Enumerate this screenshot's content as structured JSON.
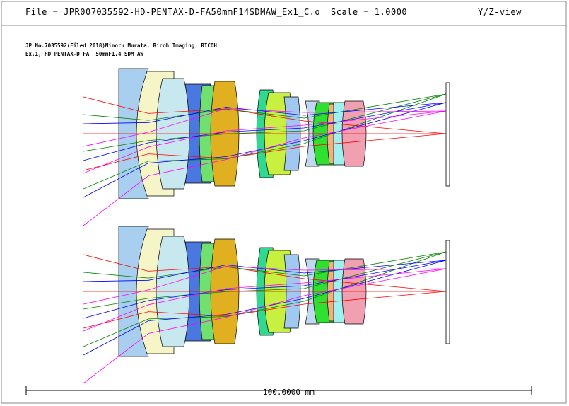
{
  "header": {
    "file_text": "File = JPR007035592-HD-PENTAX-D-FA50mmF14SDMAW_Ex1_C.o",
    "scale_text": "Scale = 1.0000",
    "view_text": "Y/Z-view"
  },
  "caption": {
    "line1": "JP No.7035592(Filed 2018)Minoru Murata, Ricoh Imaging, RICOH",
    "line2": "Ex.1, HD PENTAX-D FA  50mmF1.4 SDM AW"
  },
  "scale_bar": {
    "label": "100.0000 mm"
  },
  "colors": {
    "ray_red": "#ff0000",
    "ray_green": "#008000",
    "ray_blue": "#0000ff",
    "ray_magenta": "#ff00ff",
    "lens_outline": "#000000"
  },
  "lens_elements": [
    {
      "name": "L1",
      "color": "#a8cff0"
    },
    {
      "name": "L2",
      "color": "#f5f5c8"
    },
    {
      "name": "L3",
      "color": "#c8e8f0"
    },
    {
      "name": "L4",
      "color": "#4a78e0"
    },
    {
      "name": "L5",
      "color": "#70e070"
    },
    {
      "name": "L6",
      "color": "#e0b020"
    },
    {
      "name": "L7",
      "color": "#30d890"
    },
    {
      "name": "L8",
      "color": "#c8f040"
    },
    {
      "name": "L9",
      "color": "#a0c8f0"
    },
    {
      "name": "L10",
      "color": "#c0d8f0"
    },
    {
      "name": "L11",
      "color": "#30e030"
    },
    {
      "name": "L12",
      "color": "#f0b080"
    },
    {
      "name": "L13",
      "color": "#a0f0f0"
    },
    {
      "name": "L14",
      "color": "#f0a0b0"
    }
  ]
}
